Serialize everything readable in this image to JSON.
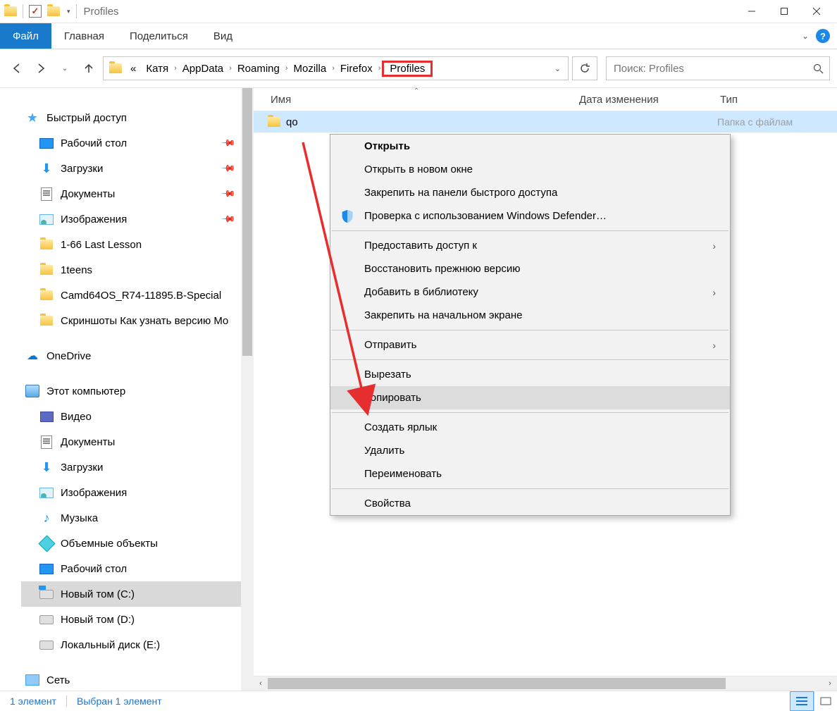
{
  "title": "Profiles",
  "tabs": {
    "file": "Файл",
    "home": "Главная",
    "share": "Поделиться",
    "view": "Вид"
  },
  "breadcrumb": {
    "prefix": "«",
    "items": [
      "Катя",
      "AppData",
      "Roaming",
      "Mozilla",
      "Firefox",
      "Profiles"
    ]
  },
  "search": {
    "placeholder": "Поиск: Profiles"
  },
  "columns": {
    "name": "Имя",
    "date": "Дата изменения",
    "type": "Тип"
  },
  "row": {
    "name": "qo",
    "date": "",
    "type": "Папка с файлам"
  },
  "sidebar": {
    "quick": "Быстрый доступ",
    "items": [
      {
        "label": "Рабочий стол",
        "icon": "desk",
        "pin": true
      },
      {
        "label": "Загрузки",
        "icon": "dl",
        "pin": true
      },
      {
        "label": "Документы",
        "icon": "doc",
        "pin": true
      },
      {
        "label": "Изображения",
        "icon": "pic",
        "pin": true
      },
      {
        "label": "1-66 Last Lesson",
        "icon": "folder"
      },
      {
        "label": "1teens",
        "icon": "folder"
      },
      {
        "label": "Camd64OS_R74-11895.B-Special",
        "icon": "folder"
      },
      {
        "label": "Скриншоты Как узнать версию Mo",
        "icon": "folder"
      }
    ],
    "onedrive": "OneDrive",
    "pc": "Этот компьютер",
    "pcitems": [
      {
        "label": "Видео",
        "icon": "vid"
      },
      {
        "label": "Документы",
        "icon": "doc"
      },
      {
        "label": "Загрузки",
        "icon": "dl"
      },
      {
        "label": "Изображения",
        "icon": "pic"
      },
      {
        "label": "Музыка",
        "icon": "mus"
      },
      {
        "label": "Объемные объекты",
        "icon": "obj"
      },
      {
        "label": "Рабочий стол",
        "icon": "desk"
      },
      {
        "label": "Новый том (C:)",
        "icon": "drvc",
        "sel": true
      },
      {
        "label": "Новый том (D:)",
        "icon": "drv"
      },
      {
        "label": "Локальный диск (E:)",
        "icon": "drv"
      }
    ],
    "net": "Сеть"
  },
  "context": [
    {
      "label": "Открыть",
      "bold": true
    },
    {
      "label": "Открыть в новом окне"
    },
    {
      "label": "Закрепить на панели быстрого доступа"
    },
    {
      "label": "Проверка с использованием Windows Defender…",
      "icon": "shield"
    },
    {
      "sep": true
    },
    {
      "label": "Предоставить доступ к",
      "sub": true
    },
    {
      "label": "Восстановить прежнюю версию"
    },
    {
      "label": "Добавить в библиотеку",
      "sub": true
    },
    {
      "label": "Закрепить на начальном экране"
    },
    {
      "sep": true
    },
    {
      "label": "Отправить",
      "sub": true
    },
    {
      "sep": true
    },
    {
      "label": "Вырезать"
    },
    {
      "label": "Копировать",
      "hov": true
    },
    {
      "sep": true
    },
    {
      "label": "Создать ярлык"
    },
    {
      "label": "Удалить"
    },
    {
      "label": "Переименовать"
    },
    {
      "sep": true
    },
    {
      "label": "Свойства"
    }
  ],
  "status": {
    "count": "1 элемент",
    "sel": "Выбран 1 элемент"
  }
}
